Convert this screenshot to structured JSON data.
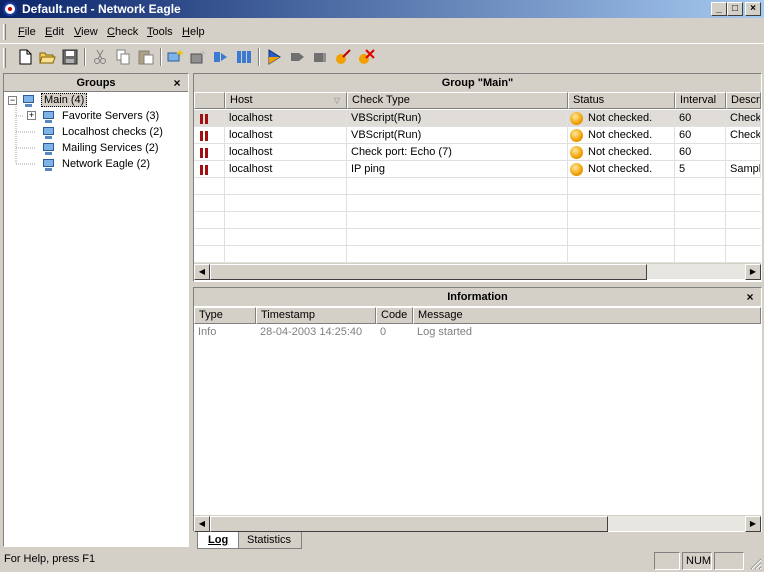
{
  "window": {
    "title": "Default.ned - Network Eagle"
  },
  "menu": [
    "File",
    "Edit",
    "View",
    "Check",
    "Tools",
    "Help"
  ],
  "toolbar": {
    "buttons": [
      "new-icon",
      "open-icon",
      "save-icon",
      "cut-icon",
      "copy-icon",
      "paste-icon",
      "add-group-icon",
      "add-check-icon",
      "move-right-icon",
      "move-columns-icon",
      "run-icon",
      "pause-icon",
      "stop-icon",
      "edit-check-icon",
      "delete-check-icon"
    ]
  },
  "groups": {
    "title": "Groups",
    "close": "×",
    "tree": [
      {
        "label": "Main (4)"
      },
      {
        "label": "Favorite Servers (3)"
      },
      {
        "label": "Localhost checks (2)"
      },
      {
        "label": "Mailing Services (2)"
      },
      {
        "label": "Network Eagle (2)"
      }
    ]
  },
  "group_panel": {
    "title": "Group \"Main\"",
    "columns": [
      "Host",
      "Check Type",
      "Status",
      "Interval",
      "Description"
    ],
    "rows": [
      {
        "host": "localhost",
        "type": "VBScript(Run)",
        "status": "Not checked.",
        "interval": "60",
        "desc": "Check"
      },
      {
        "host": "localhost",
        "type": "VBScript(Run)",
        "status": "Not checked.",
        "interval": "60",
        "desc": "Check"
      },
      {
        "host": "localhost",
        "type": "Check port: Echo (7)",
        "status": "Not checked.",
        "interval": "60",
        "desc": ""
      },
      {
        "host": "localhost",
        "type": "IP ping",
        "status": "Not checked.",
        "interval": "5",
        "desc": "Sample"
      }
    ]
  },
  "info_panel": {
    "title": "Information",
    "close": "×",
    "columns": [
      "Type",
      "Timestamp",
      "Code",
      "Message"
    ],
    "rows": [
      {
        "type": "Info",
        "timestamp": "28-04-2003 14:25:40",
        "code": "0",
        "message": "Log started"
      }
    ],
    "tabs": [
      "Log",
      "Statistics"
    ]
  },
  "statusbar": {
    "help": "For Help, press F1",
    "num": "NUM"
  }
}
